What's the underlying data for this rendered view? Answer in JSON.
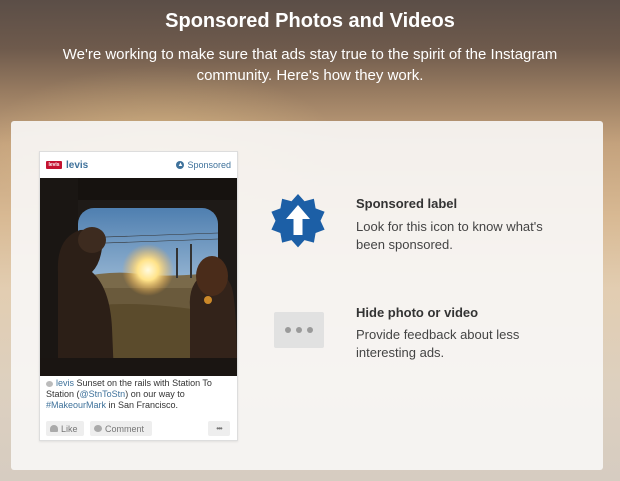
{
  "header": {
    "title": "Sponsored Photos and Videos",
    "subtitle": "We're working to make sure that ads stay true to the spirit of the Instagram community. Here's how they work."
  },
  "post": {
    "logo_text": "levis",
    "username": "levis",
    "sponsored_label": "Sponsored",
    "caption": {
      "user": "levis",
      "part1": " Sunset on the rails with Station To Station (",
      "mention": "@StnToStn",
      "part2": ") on our way to ",
      "hashtag": "#MakeourMark",
      "part3": " in San Francisco."
    },
    "like_label": "Like",
    "comment_label": "Comment",
    "more_label": "•••"
  },
  "features": [
    {
      "title": "Sponsored label",
      "text": "Look for this icon to know what's been sponsored.",
      "icon": "sponsored-badge-icon"
    },
    {
      "title": "Hide photo or video",
      "text": "Provide feedback about less interesting ads.",
      "icon": "more-dots-icon"
    }
  ],
  "colors": {
    "accent": "#3f729b",
    "badge": "#1c5fa6"
  }
}
